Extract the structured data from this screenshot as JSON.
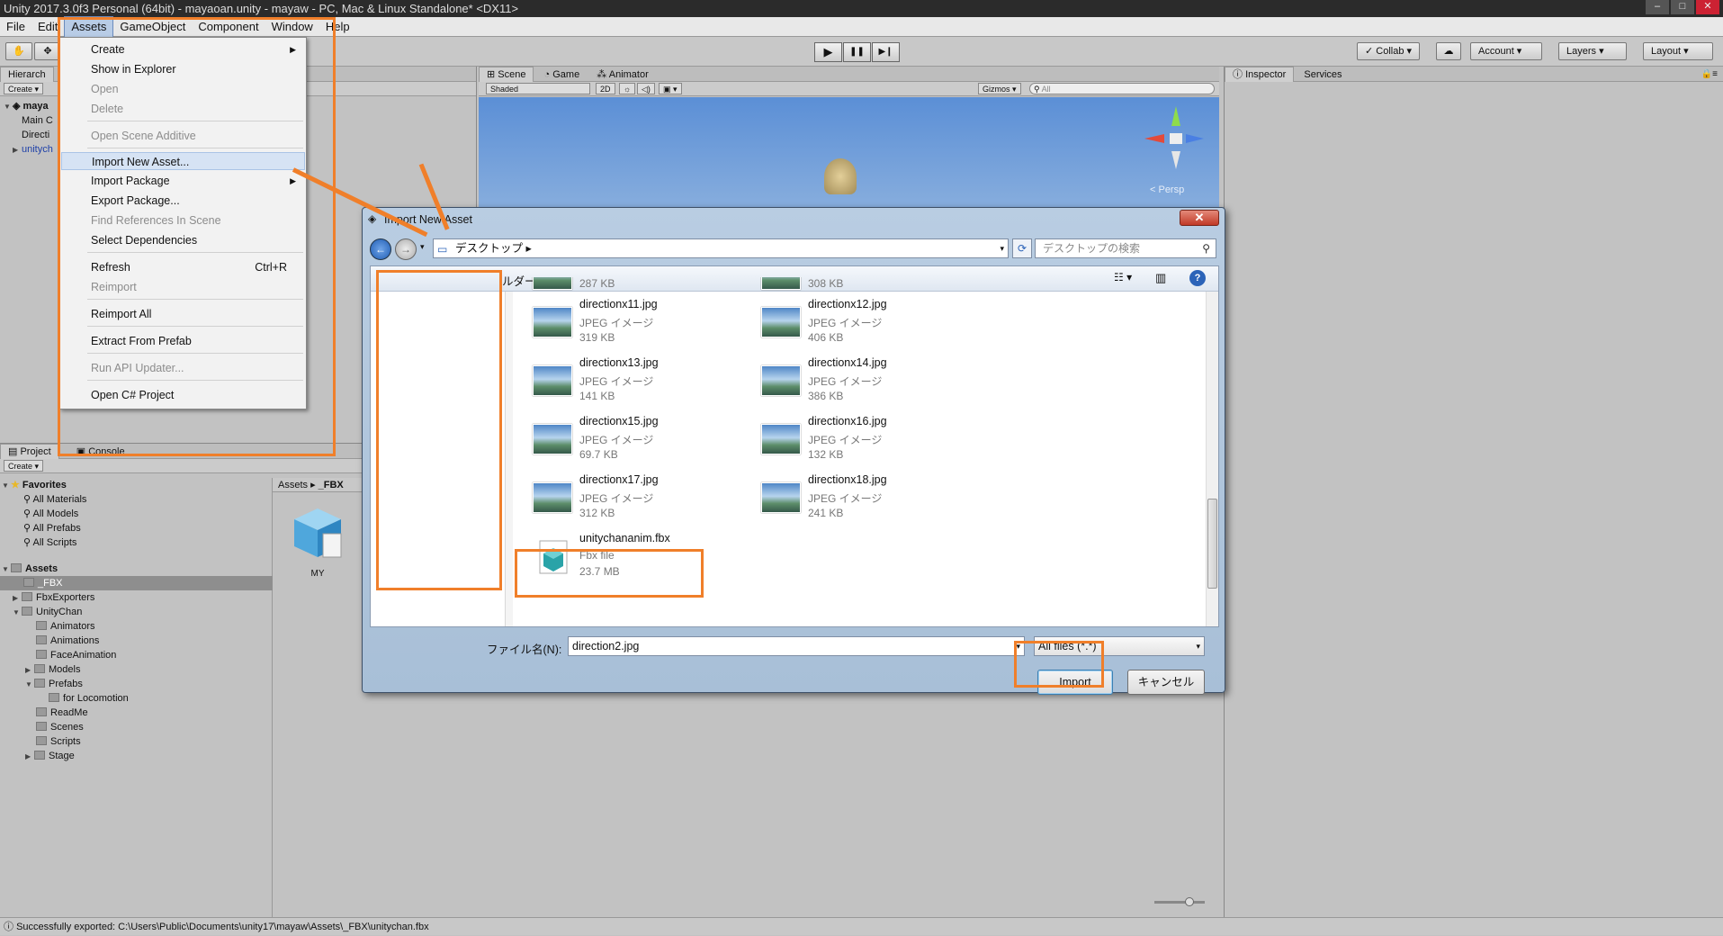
{
  "window": {
    "title": "Unity 2017.3.0f3 Personal (64bit) - mayaoan.unity - mayaw - PC, Mac & Linux Standalone* <DX11>"
  },
  "menubar": {
    "items": [
      "File",
      "Edit",
      "Assets",
      "GameObject",
      "Component",
      "Window",
      "Help"
    ]
  },
  "toolbar": {
    "play": "▶",
    "pause": "❚❚",
    "step": "▶❙",
    "collab": "Collab",
    "account": "Account",
    "layers": "Layers",
    "layout": "Layout"
  },
  "hierarchy": {
    "tab": "Hierarch",
    "create": "Create",
    "scene": "maya",
    "items": [
      "Main C",
      "Directi",
      "unitych"
    ]
  },
  "scene": {
    "tabs": [
      "Scene",
      "Game",
      "Animator"
    ],
    "shading": "Shaded",
    "mode2d": "2D",
    "gizmos": "Gizmos",
    "search_placeholder": "All",
    "persp": "< Persp"
  },
  "inspector": {
    "tabs": [
      "Inspector",
      "Services"
    ]
  },
  "assets_menu": {
    "items": [
      {
        "label": "Create",
        "shortcut": "",
        "disabled": false,
        "submenu": true
      },
      {
        "label": "Show in Explorer",
        "shortcut": "",
        "disabled": false,
        "submenu": false
      },
      {
        "label": "Open",
        "shortcut": "",
        "disabled": true,
        "submenu": false
      },
      {
        "label": "Delete",
        "shortcut": "",
        "disabled": true,
        "submenu": false
      },
      {
        "label": "Open Scene Additive",
        "shortcut": "",
        "disabled": true,
        "submenu": false
      },
      {
        "label": "Import New Asset...",
        "shortcut": "",
        "disabled": false,
        "submenu": false
      },
      {
        "label": "Import Package",
        "shortcut": "",
        "disabled": false,
        "submenu": true
      },
      {
        "label": "Export Package...",
        "shortcut": "",
        "disabled": false,
        "submenu": false
      },
      {
        "label": "Find References In Scene",
        "shortcut": "",
        "disabled": true,
        "submenu": false
      },
      {
        "label": "Select Dependencies",
        "shortcut": "",
        "disabled": false,
        "submenu": false
      },
      {
        "label": "Refresh",
        "shortcut": "Ctrl+R",
        "disabled": false,
        "submenu": false
      },
      {
        "label": "Reimport",
        "shortcut": "",
        "disabled": true,
        "submenu": false
      },
      {
        "label": "Reimport All",
        "shortcut": "",
        "disabled": false,
        "submenu": false
      },
      {
        "label": "Extract From Prefab",
        "shortcut": "",
        "disabled": false,
        "submenu": false
      },
      {
        "label": "Run API Updater...",
        "shortcut": "",
        "disabled": true,
        "submenu": false
      },
      {
        "label": "Open C# Project",
        "shortcut": "",
        "disabled": false,
        "submenu": false
      }
    ]
  },
  "dialog": {
    "title": "Import New Asset",
    "close": "✕",
    "address": "デスクトップ",
    "search_placeholder": "デスクトップの検索",
    "folder_hint": "ルダー",
    "files": [
      {
        "name": "",
        "type": "",
        "size": "287 KB"
      },
      {
        "name": "",
        "type": "",
        "size": "308 KB"
      },
      {
        "name": "directionx11.jpg",
        "type": "JPEG イメージ",
        "size": "319 KB"
      },
      {
        "name": "directionx12.jpg",
        "type": "JPEG イメージ",
        "size": "406 KB"
      },
      {
        "name": "directionx13.jpg",
        "type": "JPEG イメージ",
        "size": "141 KB"
      },
      {
        "name": "directionx14.jpg",
        "type": "JPEG イメージ",
        "size": "386 KB"
      },
      {
        "name": "directionx15.jpg",
        "type": "JPEG イメージ",
        "size": "69.7 KB"
      },
      {
        "name": "directionx16.jpg",
        "type": "JPEG イメージ",
        "size": "132 KB"
      },
      {
        "name": "directionx17.jpg",
        "type": "JPEG イメージ",
        "size": "312 KB"
      },
      {
        "name": "directionx18.jpg",
        "type": "JPEG イメージ",
        "size": "241 KB"
      },
      {
        "name": "unitychananim.fbx",
        "type": "Fbx file",
        "size": "23.7 MB"
      }
    ],
    "filename_label": "ファイル名(N):",
    "filename_value": "direction2.jpg",
    "filetype": "All files (*.*)",
    "import_button": "Import",
    "cancel_button": "キャンセル"
  },
  "project": {
    "tabs": [
      "Project",
      "Console"
    ],
    "create": "Create",
    "breadcrumb": [
      "Assets",
      "_FBX"
    ],
    "favorites_label": "Favorites",
    "favorites": [
      "All Materials",
      "All Models",
      "All Prefabs",
      "All Scripts"
    ],
    "assets_label": "Assets",
    "tree": [
      "_FBX",
      "FbxExporters",
      "UnityChan",
      "Animators",
      "Animations",
      "FaceAnimation",
      "Models",
      "Prefabs",
      "for Locomotion",
      "ReadMe",
      "Scenes",
      "Scripts",
      "Stage"
    ],
    "asset_item": "MY"
  },
  "status": {
    "text": "Successfully exported: C:\\Users\\Public\\Documents\\unity17\\mayaw\\Assets\\_FBX\\unitychan.fbx"
  },
  "colors": {
    "highlight": "#f07f2a",
    "menu_hover": "#d6e3f4",
    "dialog_frame": "#b9cde2"
  }
}
